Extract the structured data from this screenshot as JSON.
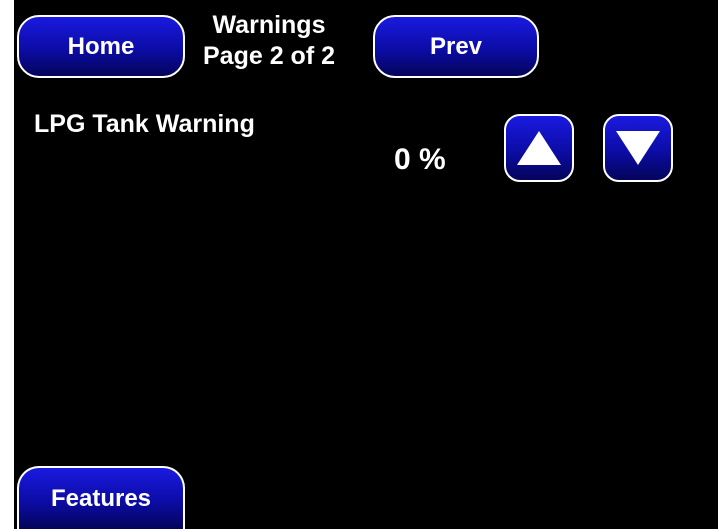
{
  "header": {
    "title_line1": "Warnings",
    "title_line2": "Page 2 of 2",
    "home_label": "Home",
    "prev_label": "Prev"
  },
  "lpg_warning": {
    "label": "LPG Tank Warning",
    "value": "0 %",
    "up_icon": "up-triangle-icon",
    "down_icon": "down-triangle-icon"
  },
  "footer": {
    "features_label": "Features"
  },
  "colors": {
    "background": "#000000",
    "button_blue": "#0c0ca6",
    "text": "#ffffff"
  }
}
